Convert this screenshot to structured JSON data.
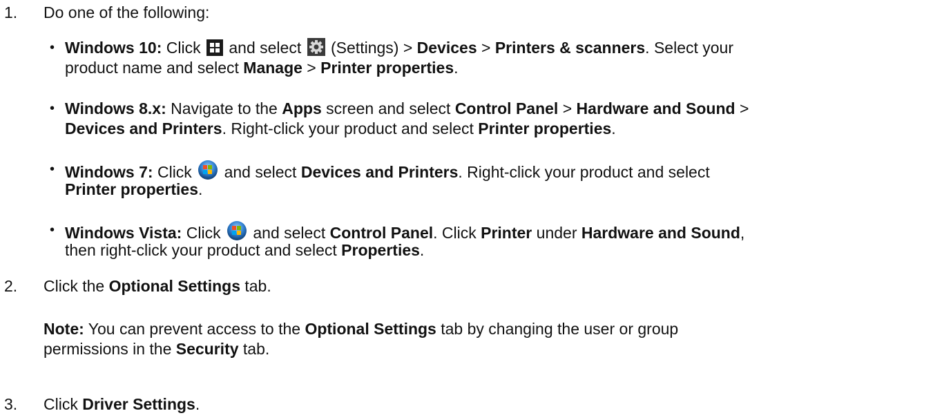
{
  "step1": {
    "num": "1.",
    "text": "Do one of the following:"
  },
  "bullets": {
    "dot": "•",
    "win10": {
      "label": "Windows 10:",
      "click": " Click ",
      "and_select": " and select ",
      "settings_paren": " (Settings) > ",
      "devices": "Devices",
      "gt1": " > ",
      "printers_scanners": "Printers & scanners",
      "select_your": ". Select your",
      "product_name": "product name and select ",
      "manage": "Manage",
      "gt2": " > ",
      "printer_properties": "Printer properties",
      "end": "."
    },
    "win8": {
      "label": "Windows 8.x:",
      "navigate": " Navigate to the ",
      "apps": "Apps",
      "screen_select": " screen and select ",
      "control_panel": "Control Panel",
      "gt1": " > ",
      "hardware_sound": "Hardware and Sound",
      "gt2": " >",
      "devices_printers": "Devices and Printers",
      "right_click": ". Right-click your product and select ",
      "printer_properties": "Printer properties",
      "end": "."
    },
    "win7": {
      "label": "Windows 7:",
      "click": " Click ",
      "and_select": " and select ",
      "devices_printers": "Devices and Printers",
      "right_click": ". Right-click your product and select",
      "printer_properties": "Printer properties",
      "end": "."
    },
    "vista": {
      "label": "Windows Vista:",
      "click": " Click ",
      "and_select": " and select ",
      "control_panel": "Control Panel",
      "click_printer": ". Click ",
      "printer": "Printer",
      "under": " under ",
      "hardware_sound": "Hardware and Sound",
      "comma": ",",
      "then": "then right-click your product and select ",
      "properties": "Properties",
      "end": "."
    }
  },
  "step2": {
    "num": "2.",
    "click_the": "Click the ",
    "optional_settings": "Optional Settings",
    "tab": " tab."
  },
  "note": {
    "label": "Note:",
    "text1": " You can prevent access to the ",
    "optional_settings": "Optional Settings",
    "text2": " tab by changing the user or group",
    "text3": "permissions in the ",
    "security": "Security",
    "text4": " tab."
  },
  "step3": {
    "num": "3.",
    "click": "Click ",
    "driver_settings": "Driver Settings",
    "end": "."
  },
  "icons": {
    "windows10_start": "windows-start-icon",
    "settings": "settings-gear-icon",
    "windows7_start": "windows-orb-icon"
  },
  "colors": {
    "text": "#111111",
    "icon_dark": "#1a1a1a",
    "orb_blue": "#2f7fd0"
  }
}
